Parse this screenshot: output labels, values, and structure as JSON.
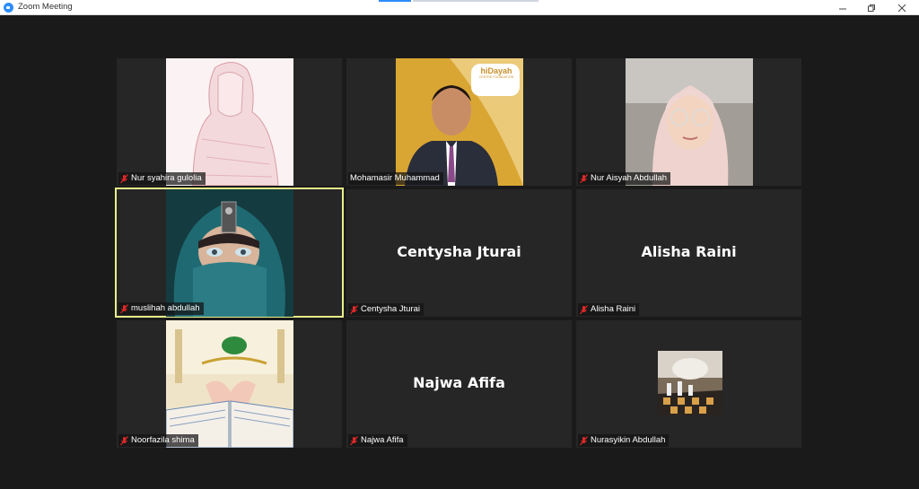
{
  "window": {
    "title": "Zoom Meeting",
    "minimize_icon": "minimize-icon",
    "maximize_icon": "restore-icon",
    "close_icon": "close-icon"
  },
  "participants": [
    {
      "name": "Nur syahira gulolia",
      "muted": true,
      "display": "video"
    },
    {
      "name": "Mohamasir Muhammad",
      "muted": false,
      "display": "video"
    },
    {
      "name": "Nur Aisyah Abdullah",
      "muted": true,
      "display": "video"
    },
    {
      "name": "muslihah abdullah",
      "muted": true,
      "display": "video",
      "active_speaker": true
    },
    {
      "name": "Centysha Jturai",
      "muted": true,
      "display": "name"
    },
    {
      "name": "Alisha Raini",
      "muted": true,
      "display": "name"
    },
    {
      "name": "Noorfazila shima",
      "muted": true,
      "display": "video"
    },
    {
      "name": "Najwa Afifa",
      "muted": true,
      "display": "name"
    },
    {
      "name": "Nurasyikin Abdullah",
      "muted": true,
      "display": "video"
    }
  ],
  "logo_text": "hiDayah",
  "logo_sub": "CENTRE FOUNDATION",
  "colors": {
    "active_border": "#e8f08a",
    "muted_icon": "#e02828",
    "zoom_blue": "#2d8cff"
  }
}
